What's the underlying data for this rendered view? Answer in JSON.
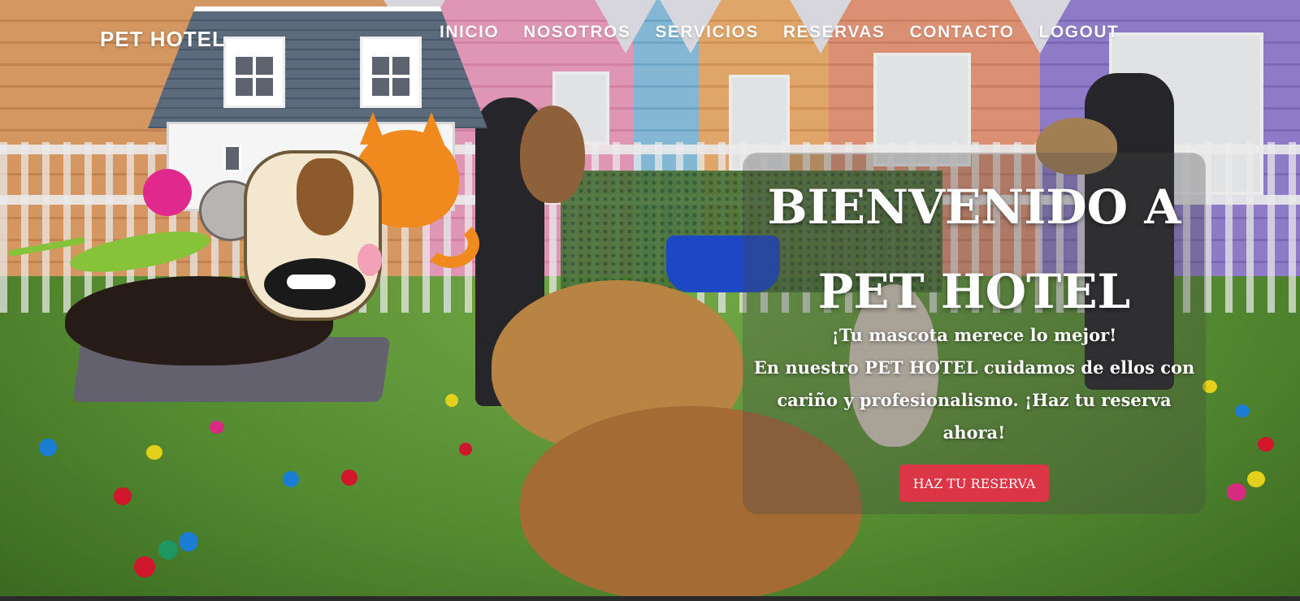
{
  "header": {
    "brand": "PET HOTEL",
    "nav": [
      {
        "label": "INICIO"
      },
      {
        "label": "NOSOTROS"
      },
      {
        "label": "SERVICIOS"
      },
      {
        "label": "RESERVAS"
      },
      {
        "label": "CONTACTO"
      },
      {
        "label": "LOGOUT"
      }
    ]
  },
  "logo": {
    "icon": "pet-hotel-logo-house-with-pets"
  },
  "hero": {
    "title_line1": "BIENVENIDO A",
    "title_line2": "PET HOTEL",
    "subtitle_line1": "¡Tu mascota merece lo mejor!",
    "subtitle_line2": "En nuestro PET HOTEL cuidamos de ellos con",
    "subtitle_line3": "cariño y profesionalismo. ¡Haz tu reserva",
    "subtitle_line4": "ahora!",
    "cta_label": "HAZ TU RESERVA"
  },
  "colors": {
    "cta_background": "#dc3545",
    "text": "#ffffff"
  },
  "background": {
    "image": "dog-daycare-room-photo"
  }
}
